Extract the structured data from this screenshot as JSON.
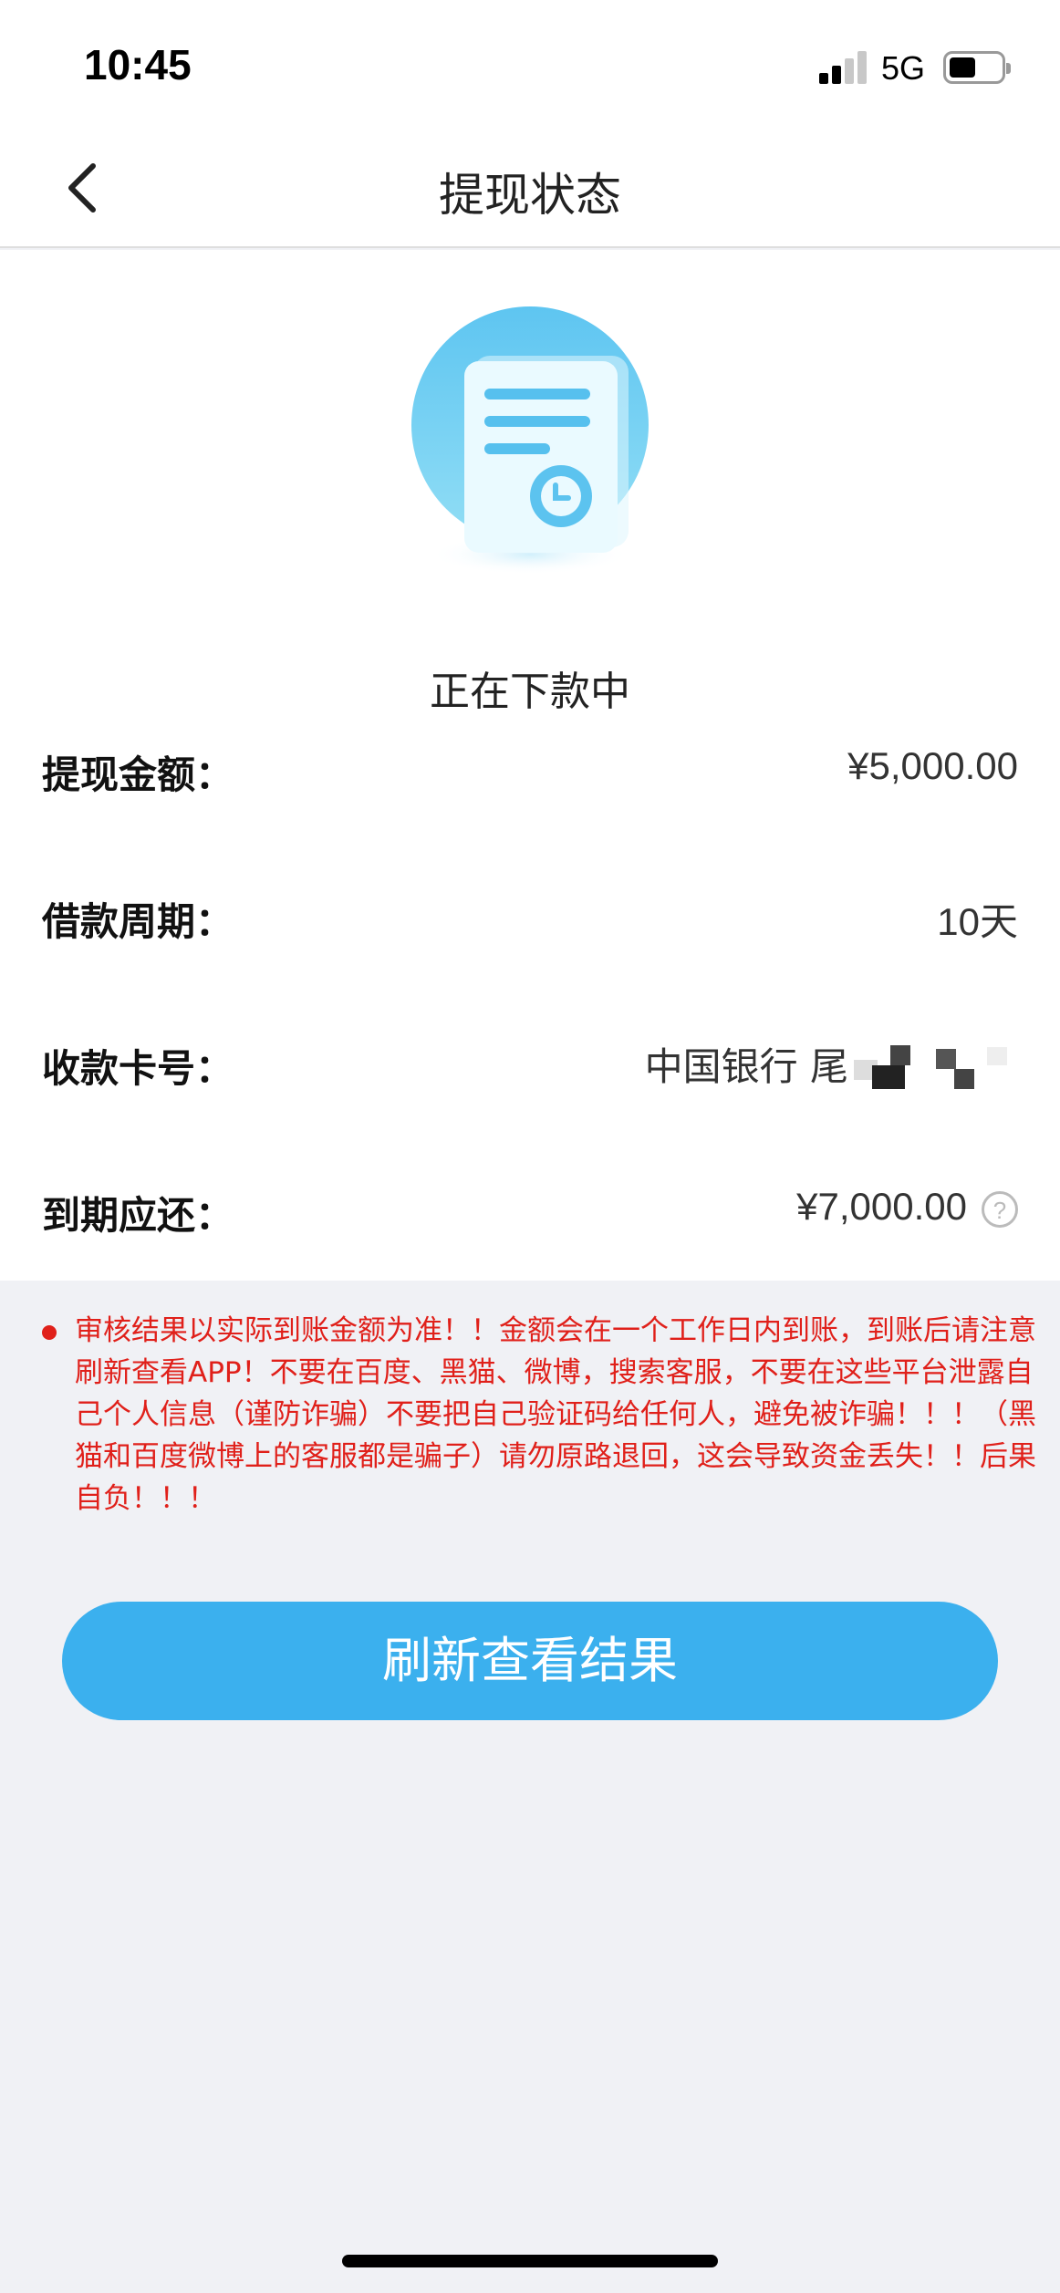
{
  "status_bar": {
    "time": "10:45",
    "network": "5G"
  },
  "navbar": {
    "title": "提现状态"
  },
  "state": {
    "text": "正在下款中"
  },
  "details": {
    "amount": {
      "label": "提现金额：",
      "value": "¥5,000.00"
    },
    "period": {
      "label": "借款周期：",
      "value": "10天"
    },
    "card": {
      "label": "收款卡号：",
      "value": "中国银行 尾"
    },
    "repay": {
      "label": "到期应还：",
      "value": "¥7,000.00",
      "help": "?"
    }
  },
  "notice": {
    "text": "审核结果以实际到账金额为准！！金额会在一个工作日内到账，到账后请注意刷新查看APP！不要在百度、黑猫、微博，搜索客服，不要在这些平台泄露自己个人信息（谨防诈骗）不要把自己验证码给任何人，避免被诈骗！！！（黑猫和百度微博上的客服都是骗子）请勿原路退回，这会导致资金丢失！！后果自负！！！",
    "color": "#e0201a"
  },
  "actions": {
    "refresh_label": "刷新查看结果"
  },
  "colors": {
    "accent": "#3bb0ee",
    "background": "#f0f1f5"
  }
}
